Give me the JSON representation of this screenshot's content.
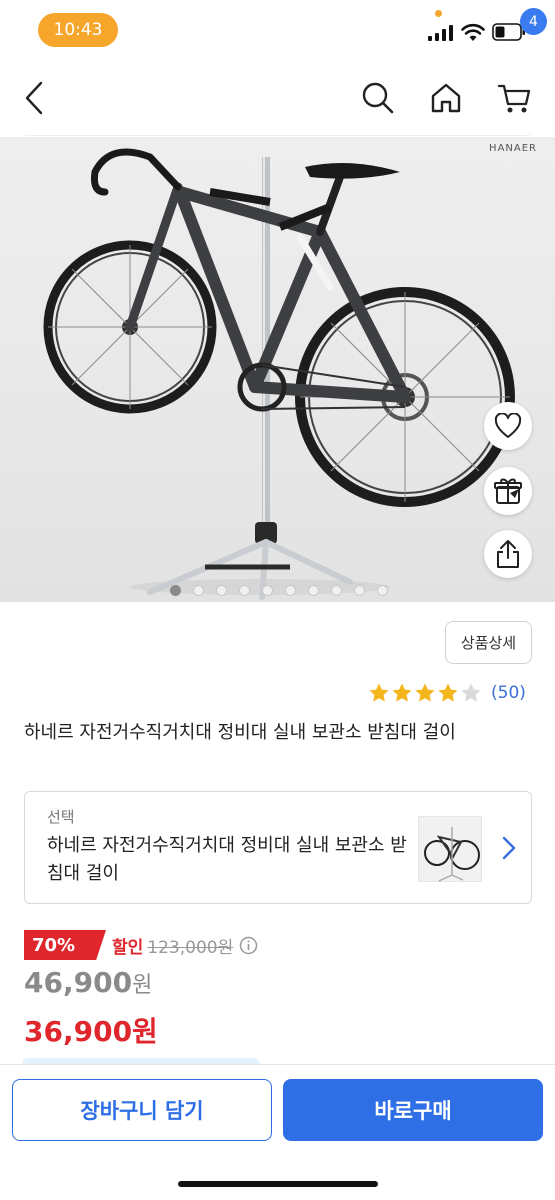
{
  "status_bar": {
    "time": "10:43",
    "accent_color": "#f7a62c"
  },
  "nav": {
    "icons": [
      "chevron-left-icon",
      "search-icon",
      "home-icon",
      "cart-icon"
    ],
    "cart_badge": "4"
  },
  "hero": {
    "brand": "HANAER",
    "slide_count": 10,
    "active_slide": 1,
    "side_icons": [
      "heart-icon",
      "gift-icon",
      "share-icon"
    ]
  },
  "product": {
    "detail_button": "상품상세",
    "rating_stars": 4,
    "rating_max": 5,
    "review_count": "(50)",
    "title": "하네르 자전거수직거치대 정비대 실내 보관소 받침대 걸이"
  },
  "option": {
    "caption": "선택",
    "text": "하네르 자전거수직거치대 정비대 실내 보관소 받침대 걸이"
  },
  "pricing": {
    "discount_rate": "70%",
    "discount_label": "할인",
    "original_price": "123,000원",
    "price_gray": "46,900",
    "price_gray_unit": "원",
    "price_final": "36,900원",
    "accent_red": "#e0262d"
  },
  "bottom_bar": {
    "cart_button": "장바구니 담기",
    "buy_button": "바로구매",
    "accent_blue": "#2f6fe6"
  }
}
